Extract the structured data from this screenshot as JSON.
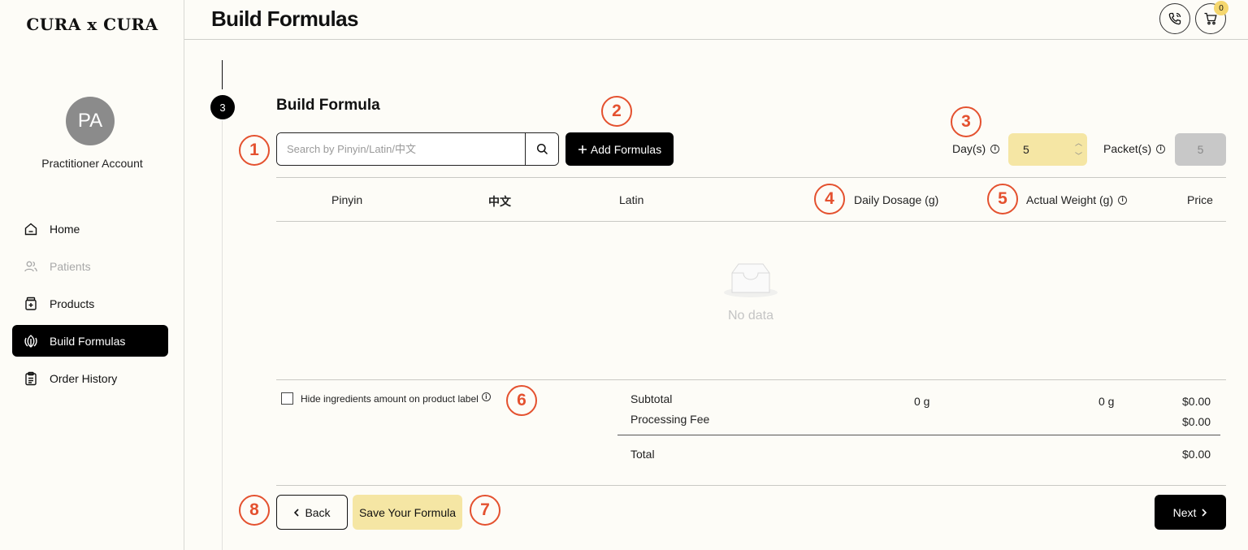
{
  "sidebar": {
    "brand": "CURA x CURA",
    "avatar_initials": "PA",
    "account_name": "Practitioner Account",
    "items": [
      {
        "label": "Home",
        "icon": "home-icon",
        "state": "normal"
      },
      {
        "label": "Patients",
        "icon": "users-icon",
        "state": "disabled"
      },
      {
        "label": "Products",
        "icon": "product-jar-icon",
        "state": "normal"
      },
      {
        "label": "Build Formulas",
        "icon": "leaf-icon",
        "state": "active"
      },
      {
        "label": "Order History",
        "icon": "clipboard-icon",
        "state": "normal"
      }
    ]
  },
  "header": {
    "title": "Build Formulas",
    "cart_count": "0"
  },
  "step": {
    "number": "3",
    "title": "Build Formula"
  },
  "search": {
    "placeholder": "Search by Pinyin/Latin/中文"
  },
  "add_button": "Add Formulas",
  "days": {
    "label": "Day(s)",
    "value": "5"
  },
  "packets": {
    "label": "Packet(s)",
    "value": "5"
  },
  "table": {
    "columns": [
      "Pinyin",
      "中文",
      "Latin",
      "Daily Dosage (g)",
      "Actual Weight (g)",
      "Price"
    ],
    "empty_text": "No data"
  },
  "hide_ingredients_label": "Hide ingredients amount on product label",
  "totals": {
    "subtotal_label": "Subtotal",
    "subtotal_daily": "0 g",
    "subtotal_weight": "0 g",
    "subtotal_price": "$0.00",
    "processing_label": "Processing Fee",
    "processing_price": "$0.00",
    "total_label": "Total",
    "total_price": "$0.00"
  },
  "buttons": {
    "back": "Back",
    "save": "Save Your Formula",
    "next": "Next"
  },
  "annotations": [
    "1",
    "2",
    "3",
    "4",
    "5",
    "6",
    "7",
    "8"
  ],
  "colors": {
    "accent_yellow": "#f5e6a4",
    "annotation_red": "#e4512f",
    "primary_black": "#000000",
    "background": "#fdfcf7"
  }
}
